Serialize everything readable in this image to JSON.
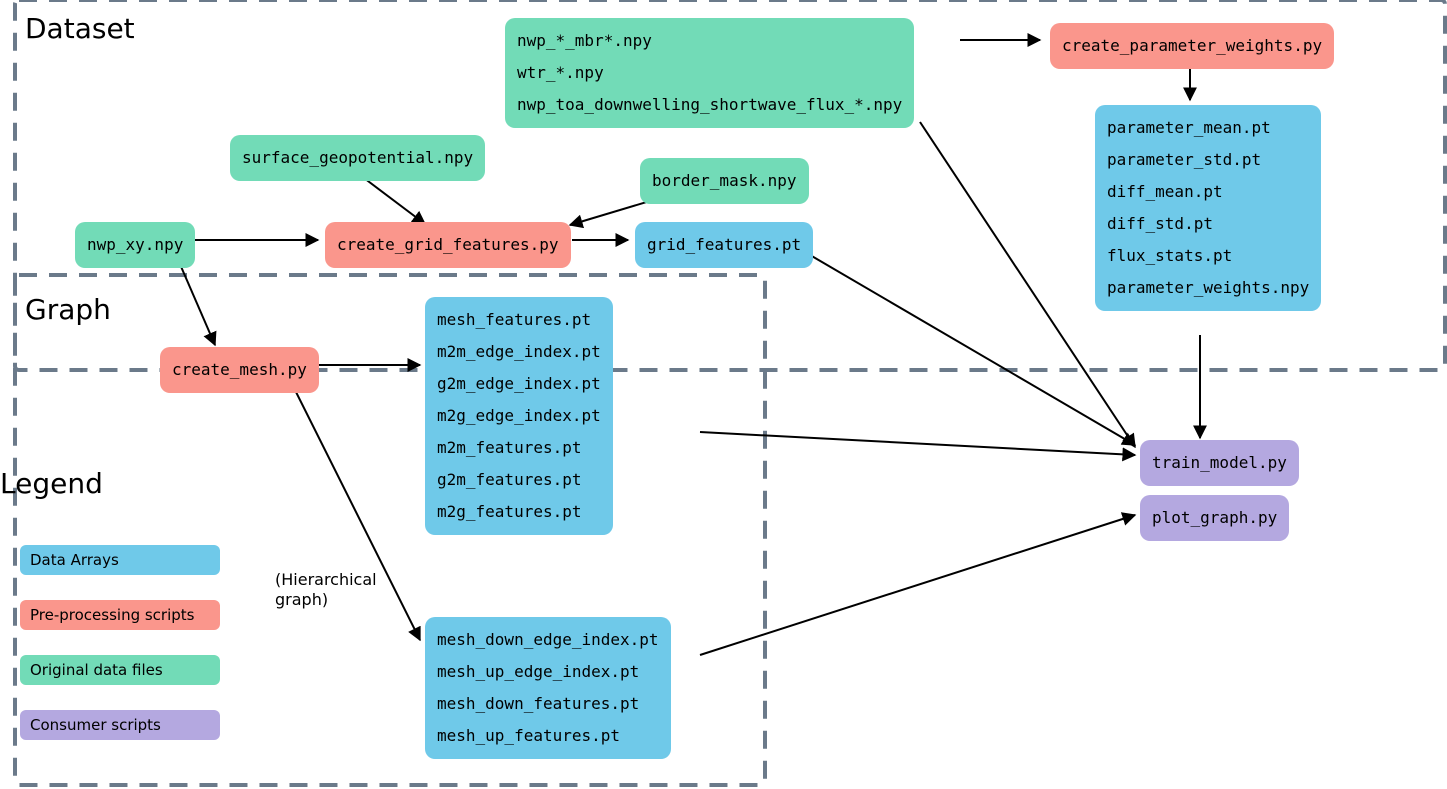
{
  "sheets": {
    "dataset_label": "Dataset",
    "graph_label": "Graph"
  },
  "nodes": {
    "nwp_files": "nwp_*_mbr*.npy\nwtr_*.npy\nnwp_toa_downwelling_shortwave_flux_*.npy",
    "surface_geo": "surface_geopotential.npy",
    "border_mask": "border_mask.npy",
    "nwp_xy": "nwp_xy.npy",
    "create_param_weights": "create_parameter_weights.py",
    "param_outputs": "parameter_mean.pt\nparameter_std.pt\ndiff_mean.pt\ndiff_std.pt\nflux_stats.pt\nparameter_weights.npy",
    "create_grid_features": "create_grid_features.py",
    "grid_features": "grid_features.pt",
    "create_mesh": "create_mesh.py",
    "mesh_outputs": "mesh_features.pt\nm2m_edge_index.pt\ng2m_edge_index.pt\nm2g_edge_index.pt\nm2m_features.pt\ng2m_features.pt\nm2g_features.pt",
    "mesh_hier_outputs": "mesh_down_edge_index.pt\nmesh_up_edge_index.pt\nmesh_down_features.pt\nmesh_up_features.pt",
    "train_model": "train_model.py",
    "plot_graph": "plot_graph.py"
  },
  "annotations": {
    "hierarchical_note": "(Hierarchical\ngraph)"
  },
  "legend": {
    "title": "Legend",
    "data_arrays": "Data Arrays",
    "pre_processing": "Pre-processing scripts",
    "original_data": "Original data files",
    "consumer_scripts": "Consumer scripts"
  },
  "colors": {
    "green": "#72dbb7",
    "salmon": "#fa968c",
    "blue": "#6fc9e9",
    "violet": "#b4a8e0",
    "sheet_border": "#6b7a8a"
  }
}
